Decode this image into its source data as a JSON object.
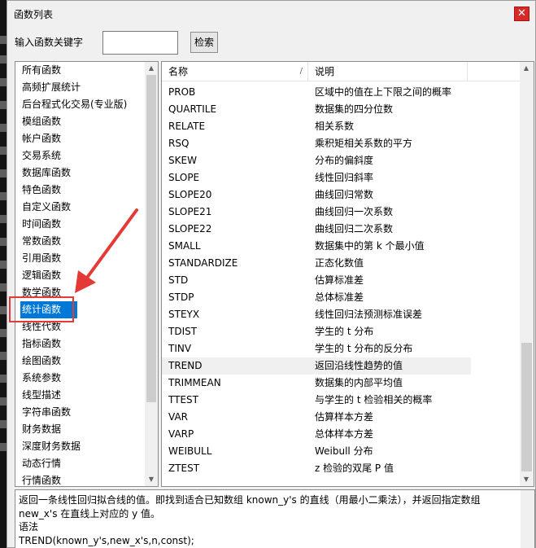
{
  "window": {
    "title": "函数列表",
    "close_glyph": "✕"
  },
  "search": {
    "label": "输入函数关键字",
    "value": "",
    "placeholder": "",
    "button": "检索"
  },
  "categories": [
    {
      "label": "所有函数"
    },
    {
      "label": "高频扩展统计"
    },
    {
      "label": "后台程式化交易(专业版)"
    },
    {
      "label": "模组函数"
    },
    {
      "label": "帐户函数"
    },
    {
      "label": "交易系统"
    },
    {
      "label": "数据库函数"
    },
    {
      "label": "特色函数"
    },
    {
      "label": "自定义函数"
    },
    {
      "label": "时间函数"
    },
    {
      "label": "常数函数"
    },
    {
      "label": "引用函数"
    },
    {
      "label": "逻辑函数"
    },
    {
      "label": "数学函数"
    },
    {
      "label": "统计函数",
      "selected": true
    },
    {
      "label": "线性代数"
    },
    {
      "label": "指标函数"
    },
    {
      "label": "绘图函数"
    },
    {
      "label": "系统参数"
    },
    {
      "label": "线型描述"
    },
    {
      "label": "字符串函数"
    },
    {
      "label": "财务数据"
    },
    {
      "label": "深度财务数据"
    },
    {
      "label": "动态行情"
    },
    {
      "label": "行情函数"
    }
  ],
  "table": {
    "columns": {
      "name": "名称",
      "desc": "说明",
      "sort_glyph": "/"
    },
    "rows": [
      {
        "name": "PROB",
        "desc": "区域中的值在上下限之间的概率"
      },
      {
        "name": "QUARTILE",
        "desc": "数据集的四分位数"
      },
      {
        "name": "RELATE",
        "desc": "相关系数"
      },
      {
        "name": "RSQ",
        "desc": "乘积矩相关系数的平方"
      },
      {
        "name": "SKEW",
        "desc": "分布的偏斜度"
      },
      {
        "name": "SLOPE",
        "desc": "线性回归斜率"
      },
      {
        "name": "SLOPE20",
        "desc": "曲线回归常数"
      },
      {
        "name": "SLOPE21",
        "desc": "曲线回归一次系数"
      },
      {
        "name": "SLOPE22",
        "desc": "曲线回归二次系数"
      },
      {
        "name": "SMALL",
        "desc": "数据集中的第 k 个最小值"
      },
      {
        "name": "STANDARDIZE",
        "desc": "正态化数值"
      },
      {
        "name": "STD",
        "desc": "估算标准差"
      },
      {
        "name": "STDP",
        "desc": "总体标准差"
      },
      {
        "name": "STEYX",
        "desc": "线性回归法预测标准误差"
      },
      {
        "name": "TDIST",
        "desc": "学生的 t 分布"
      },
      {
        "name": "TINV",
        "desc": "学生的 t 分布的反分布"
      },
      {
        "name": "TREND",
        "desc": "返回沿线性趋势的值",
        "highlighted": true
      },
      {
        "name": "TRIMMEAN",
        "desc": "数据集的内部平均值"
      },
      {
        "name": "TTEST",
        "desc": "与学生的 t 检验相关的概率"
      },
      {
        "name": "VAR",
        "desc": "估算样本方差"
      },
      {
        "name": "VARP",
        "desc": "总体样本方差"
      },
      {
        "name": "WEIBULL",
        "desc": "Weibull 分布"
      },
      {
        "name": "ZTEST",
        "desc": "z 检验的双尾 P 值"
      }
    ]
  },
  "description": {
    "text": "返回一条线性回归拟合线的值。即找到适合已知数组 known_y's 的直线（用最小二乘法），并返回指定数组\nnew_x's 在直线上对应的 y 值。\n语法\nTREND(known_y's,new_x's,n,const);"
  },
  "icons": {
    "scroll_up": "▲",
    "scroll_down": "▼"
  },
  "colors": {
    "selection": "#0078d7",
    "callout": "#e53935",
    "close": "#d42a2a"
  }
}
